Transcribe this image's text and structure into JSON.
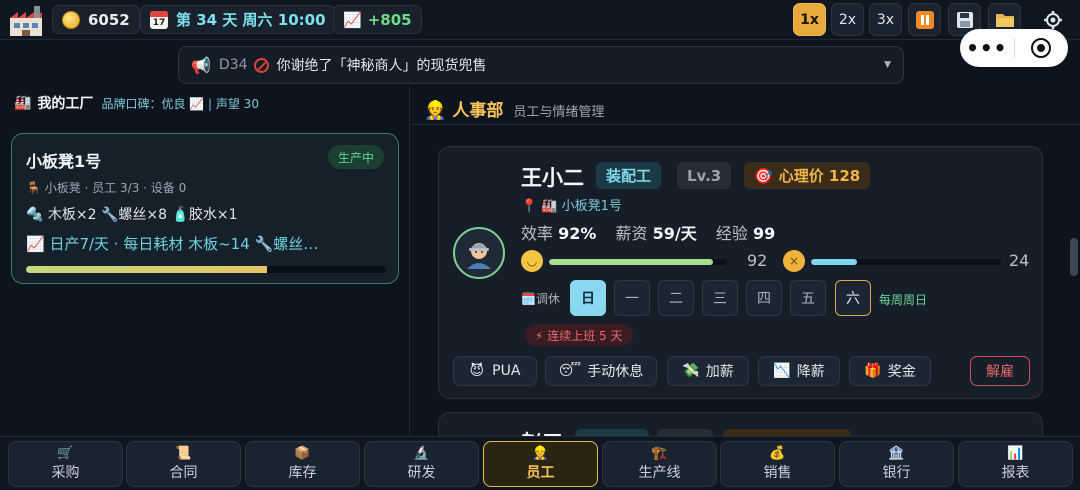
{
  "topbar": {
    "money": "6052",
    "date": "第 34 天 周六 10:00",
    "calendar_day": "17",
    "growth": "+805",
    "speeds": [
      "1x",
      "2x",
      "3x"
    ],
    "active_speed": "1x",
    "icons": [
      "factory-logo-icon",
      "coin-icon",
      "calendar-icon",
      "chart-up-icon",
      "pause-icon",
      "save-icon",
      "folder-icon",
      "gear-icon"
    ]
  },
  "notification": {
    "day": "D34",
    "text": "你谢绝了「神秘商人」的现货兜售"
  },
  "miniprogram": {
    "menu": "•••"
  },
  "left": {
    "title": "我的工厂",
    "meta": "品牌口碑：优良 📈 | 声望 30",
    "factory": {
      "name": "小板凳1号",
      "status": "生产中",
      "sub": "小板凳 · 员工 3/3 · 设备 0",
      "materials": "🔩 木板×2 🔧螺丝×8 🧴胶水×1",
      "output": "📈 日产7/天 · 每日耗材 木板~14 🔧螺丝…",
      "progress": 0.67
    }
  },
  "right": {
    "title": "人事部",
    "subtitle": "员工与情绪管理",
    "employee": {
      "name": "王小二",
      "role": "装配工",
      "level": "Lv.3",
      "price": "心理价 128",
      "factory": "小板凳1号",
      "eff_label": "效率",
      "eff": "92%",
      "salary_label": "薪资",
      "salary": "59/天",
      "exp_label": "经验",
      "exp": "99",
      "mood": 92,
      "mood_text": "92",
      "fatigue": 24,
      "fatigue_text": "24",
      "rest_label": "调休",
      "days": [
        "日",
        "一",
        "二",
        "三",
        "四",
        "五",
        "六"
      ],
      "rest_day": "日",
      "weekend_day": "六",
      "day_note": "每周周日",
      "streak": "⚡ 连续上班 5 天",
      "actions": {
        "pua": "PUA",
        "rest": "手动休息",
        "raise": "加薪",
        "cut": "降薪",
        "bonus": "奖金",
        "fire": "解雇"
      }
    },
    "next_employee_name": "赵三"
  },
  "nav": [
    {
      "icon": "🛒",
      "label": "采购"
    },
    {
      "icon": "📜",
      "label": "合同"
    },
    {
      "icon": "📦",
      "label": "库存"
    },
    {
      "icon": "🔬",
      "label": "研发"
    },
    {
      "icon": "👷",
      "label": "员工"
    },
    {
      "icon": "🏗️",
      "label": "生产线"
    },
    {
      "icon": "💰",
      "label": "销售"
    },
    {
      "icon": "🏦",
      "label": "银行"
    },
    {
      "icon": "📊",
      "label": "报表"
    }
  ],
  "active_nav": "员工",
  "colors": {
    "accent": "#e8a93a",
    "positive": "#6fdc8c",
    "teal": "#7ec8d8",
    "danger": "#ee6a6a"
  }
}
